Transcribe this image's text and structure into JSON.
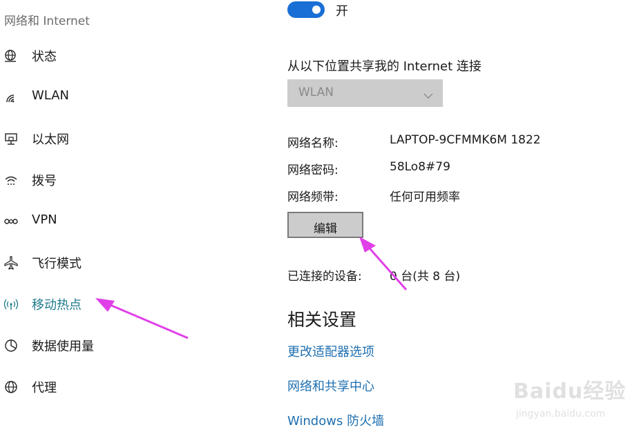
{
  "sidebar": {
    "section_title": "网络和 Internet",
    "items": [
      {
        "label": "状态",
        "icon": "globe-status-icon"
      },
      {
        "label": "WLAN",
        "icon": "wifi-icon"
      },
      {
        "label": "以太网",
        "icon": "ethernet-icon"
      },
      {
        "label": "拨号",
        "icon": "dialup-icon"
      },
      {
        "label": "VPN",
        "icon": "vpn-icon"
      },
      {
        "label": "飞行模式",
        "icon": "airplane-icon"
      },
      {
        "label": "移动热点",
        "icon": "hotspot-icon",
        "active": true
      },
      {
        "label": "数据使用量",
        "icon": "data-usage-icon"
      },
      {
        "label": "代理",
        "icon": "proxy-globe-icon"
      }
    ]
  },
  "hotspot": {
    "toggle_state": "开",
    "toggle_on": true,
    "share_from_label": "从以下位置共享我的 Internet 连接",
    "share_from_value": "WLAN",
    "network_name_label": "网络名称:",
    "network_name_value": "LAPTOP-9CFMMK6M 1822",
    "network_password_label": "网络密码:",
    "network_password_value": "58Lo8#79",
    "network_band_label": "网络频带:",
    "network_band_value": "任何可用频率",
    "edit_button_label": "编辑",
    "connected_devices_label": "已连接的设备:",
    "connected_devices_value": "0 台(共 8 台)"
  },
  "related": {
    "title": "相关设置",
    "links": [
      "更改适配器选项",
      "网络和共享中心",
      "Windows 防火墙"
    ]
  },
  "watermark": {
    "main": "Baidu经验",
    "sub": "jingyan.baidu.com"
  },
  "colors": {
    "accent": "#1a6fd6",
    "active_nav": "#1e7a8c",
    "link": "#1e6fb0",
    "annotation_arrow": "#e040e8"
  }
}
